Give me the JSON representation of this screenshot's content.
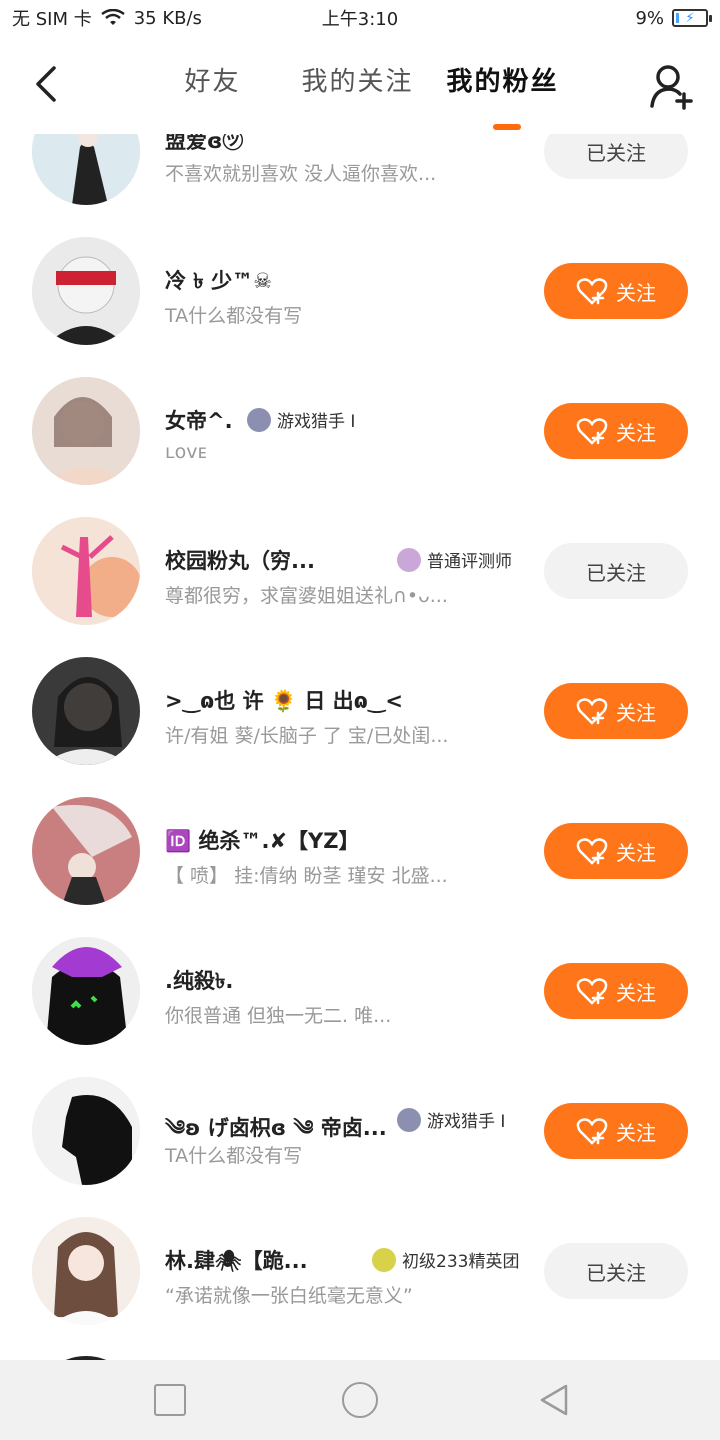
{
  "status_bar": {
    "left_text": "无 SIM 卡",
    "speed": "35 KB/s",
    "time": "上午3:10",
    "battery": "9%"
  },
  "header": {
    "tabs": [
      {
        "label": "好友"
      },
      {
        "label": "我的关注"
      },
      {
        "label": "我的粉丝"
      }
    ]
  },
  "fans": [
    {
      "name": "盟爱ɞ㋡",
      "sig": "不喜欢就别喜欢 没人逼你喜欢...",
      "badge": "",
      "button": "已关注",
      "followed": true,
      "avatar": "#d9e6ea"
    },
    {
      "name": "冷 ৳ 少™☠",
      "sig": "TA什么都没有写",
      "badge": "",
      "button": "关注",
      "followed": false,
      "avatar": "#e5e5e5"
    },
    {
      "name": "女帝^.",
      "sig": "ʟᴏᴠᴇ",
      "badge": "游戏猎手 I",
      "button": "关注",
      "followed": false,
      "avatar": "#e8d6cf"
    },
    {
      "name": "校园粉丸（穷...",
      "sig": "尊都很穷，求富婆姐姐送礼∩•ᴗ...",
      "badge": "普通评测师",
      "button": "已关注",
      "followed": true,
      "avatar": "#f1d7c6"
    },
    {
      "name": ">‿ɷ也 许 🌻 日 出ɷ‿<",
      "sig": "许/有姐 葵/长脑子 了 宝/已处闺...",
      "badge": "",
      "button": "关注",
      "followed": false,
      "avatar": "#5d5d5d"
    },
    {
      "name": "🆔 绝杀™.✘【YZ】",
      "sig": "【 喷】 挂:倩纳 盼茎 瑾安 北盛...",
      "badge": "",
      "button": "关注",
      "followed": false,
      "avatar": "#d59a9a"
    },
    {
      "name": ".纯殺৳.",
      "sig": "你很普通 但独一无二.        唯...",
      "badge": "",
      "button": "关注",
      "followed": false,
      "avatar": "#2b2b2b"
    },
    {
      "name": "༄ʚ げ卤枳ɞ ༄ 帝卤...",
      "sig": "TA什么都没有写",
      "badge": "游戏猎手 I",
      "button": "关注",
      "followed": false,
      "avatar": "#9a9a9a"
    },
    {
      "name": "林.肆🕷【跪...",
      "sig": "“承诺就像一张白纸毫无意义”",
      "badge": "初级233精英团",
      "button": "已关注",
      "followed": true,
      "avatar": "#efe7e1"
    }
  ]
}
